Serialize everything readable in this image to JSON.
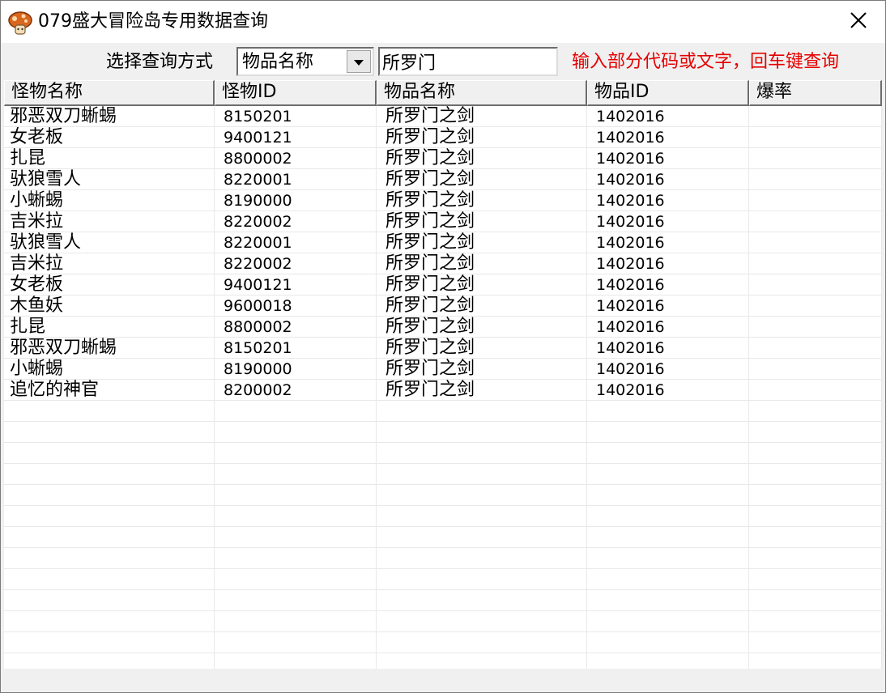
{
  "window": {
    "title": "079盛大冒险岛专用数据查询",
    "icon": "mushroom-icon",
    "close_icon": "close-icon"
  },
  "toolbar": {
    "query_label": "选择查询方式",
    "select_value": "物品名称",
    "search_value": "所罗门",
    "hint": "输入部分代码或文字，回车键查询",
    "hint_color": "#e60000"
  },
  "table": {
    "columns": [
      "怪物名称",
      "怪物ID",
      "物品名称",
      "物品ID",
      "爆率"
    ],
    "rows": [
      [
        "邪恶双刀蜥蜴",
        "8150201",
        "所罗门之剑",
        "1402016",
        ""
      ],
      [
        "女老板",
        "9400121",
        "所罗门之剑",
        "1402016",
        ""
      ],
      [
        "扎昆",
        "8800002",
        "所罗门之剑",
        "1402016",
        ""
      ],
      [
        "驮狼雪人",
        "8220001",
        "所罗门之剑",
        "1402016",
        ""
      ],
      [
        "小蜥蜴",
        "8190000",
        "所罗门之剑",
        "1402016",
        ""
      ],
      [
        "吉米拉",
        "8220002",
        "所罗门之剑",
        "1402016",
        ""
      ],
      [
        "驮狼雪人",
        "8220001",
        "所罗门之剑",
        "1402016",
        ""
      ],
      [
        "吉米拉",
        "8220002",
        "所罗门之剑",
        "1402016",
        ""
      ],
      [
        "女老板",
        "9400121",
        "所罗门之剑",
        "1402016",
        ""
      ],
      [
        "木鱼妖",
        "9600018",
        "所罗门之剑",
        "1402016",
        ""
      ],
      [
        "扎昆",
        "8800002",
        "所罗门之剑",
        "1402016",
        ""
      ],
      [
        "邪恶双刀蜥蜴",
        "8150201",
        "所罗门之剑",
        "1402016",
        ""
      ],
      [
        "小蜥蜴",
        "8190000",
        "所罗门之剑",
        "1402016",
        ""
      ],
      [
        "追忆的神官",
        "8200002",
        "所罗门之剑",
        "1402016",
        ""
      ]
    ]
  }
}
